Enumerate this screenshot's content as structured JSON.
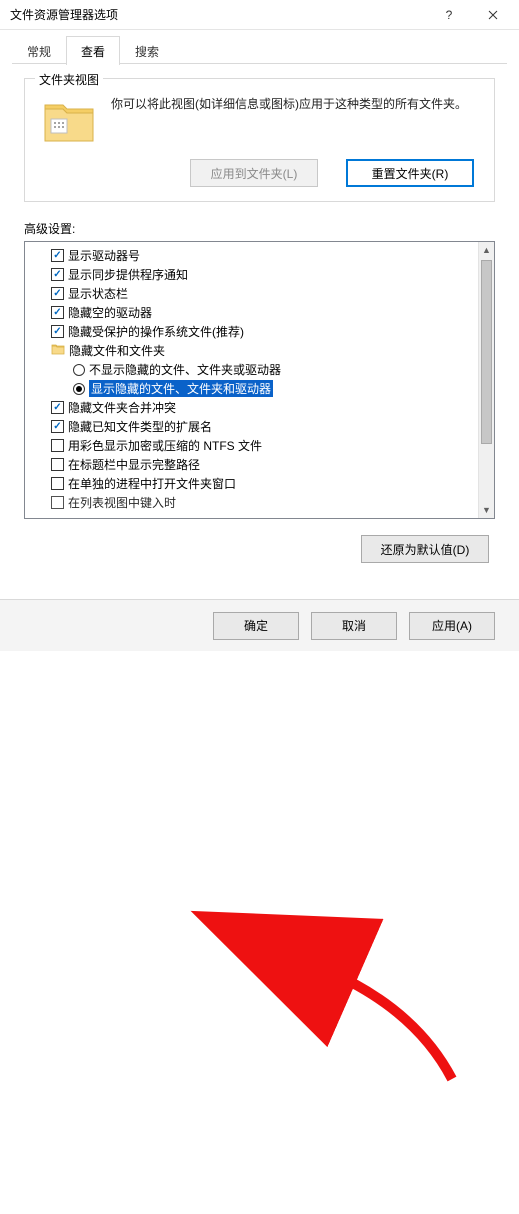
{
  "window": {
    "title": "文件资源管理器选项"
  },
  "tabs": {
    "general": "常规",
    "view": "查看",
    "search": "搜索"
  },
  "folderView": {
    "group_title": "文件夹视图",
    "desc": "你可以将此视图(如详细信息或图标)应用于这种类型的所有文件夹。",
    "apply": "应用到文件夹(L)",
    "reset": "重置文件夹(R)"
  },
  "advanced": {
    "label": "高级设置:",
    "restore_defaults": "还原为默认值(D)",
    "items": [
      {
        "kind": "check",
        "checked": true,
        "label": "显示驱动器号"
      },
      {
        "kind": "check",
        "checked": true,
        "label": "显示同步提供程序通知"
      },
      {
        "kind": "check",
        "checked": true,
        "label": "显示状态栏"
      },
      {
        "kind": "check",
        "checked": true,
        "label": "隐藏空的驱动器"
      },
      {
        "kind": "check",
        "checked": true,
        "label": "隐藏受保护的操作系统文件(推荐)"
      },
      {
        "kind": "folder",
        "label": "隐藏文件和文件夹"
      },
      {
        "kind": "radio",
        "checked": false,
        "level": 2,
        "label": "不显示隐藏的文件、文件夹或驱动器"
      },
      {
        "kind": "radio",
        "checked": true,
        "level": 2,
        "selected": true,
        "label": "显示隐藏的文件、文件夹和驱动器"
      },
      {
        "kind": "check",
        "checked": true,
        "label": "隐藏文件夹合并冲突"
      },
      {
        "kind": "check",
        "checked": true,
        "label": "隐藏已知文件类型的扩展名"
      },
      {
        "kind": "check",
        "checked": false,
        "label": "用彩色显示加密或压缩的 NTFS 文件"
      },
      {
        "kind": "check",
        "checked": false,
        "label": "在标题栏中显示完整路径"
      },
      {
        "kind": "check",
        "checked": false,
        "label": "在单独的进程中打开文件夹窗口"
      },
      {
        "kind": "check",
        "checked": false,
        "cut": true,
        "label": "在列表视图中键入时"
      }
    ]
  },
  "footer": {
    "ok": "确定",
    "cancel": "取消",
    "apply": "应用(A)"
  }
}
